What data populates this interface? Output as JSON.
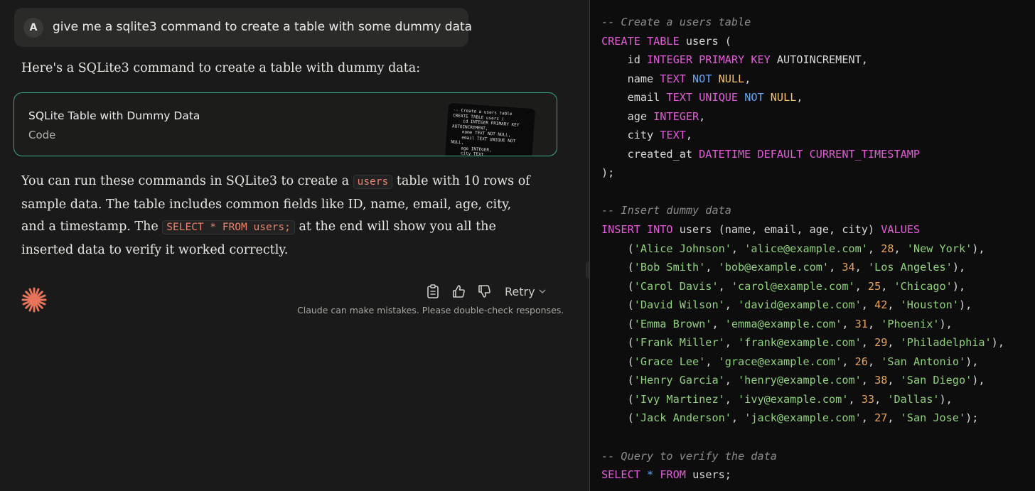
{
  "user_message": {
    "avatar_letter": "A",
    "text": "give me a sqlite3 command to create a table with some dummy data"
  },
  "response": {
    "intro": "Here's a SQLite3 command to create a table with dummy data:",
    "artifact": {
      "title": "SQLite Table with Dummy Data",
      "subtitle": "Code",
      "thumbnail_text": "-- Create a users table\nCREATE TABLE users (\n    id INTEGER PRIMARY KEY\nAUTOINCREMENT,\n    name TEXT NOT NULL,\n    email TEXT UNIQUE NOT\nNULL,\n    age INTEGER,\n    city TEXT,\n    created_..."
    },
    "body": {
      "part1": "You can run these commands in SQLite3 to create a ",
      "code1": "users",
      "part2": " table with 10 rows of sample data. The table includes common fields like ID, name, email, age, city, and a timestamp. The ",
      "code2": "SELECT * FROM users;",
      "part3": " at the end will show you all the inserted data to verify it worked correctly."
    },
    "actions": {
      "copy_icon": "clipboard-icon",
      "thumbs_up_icon": "thumbs-up-icon",
      "thumbs_down_icon": "thumbs-down-icon",
      "retry_label": "Retry"
    },
    "disclaimer": "Claude can make mistakes. Please double-check responses."
  },
  "code_panel": {
    "comment_create": "-- Create a users table",
    "comment_insert": "-- Insert dummy data",
    "comment_query": "-- Query to verify the data",
    "rows": [
      {
        "name": "'Alice Johnson'",
        "email": "'alice@example.com'",
        "age": "28",
        "city": "'New York'",
        "end": "),"
      },
      {
        "name": "'Bob Smith'",
        "email": "'bob@example.com'",
        "age": "34",
        "city": "'Los Angeles'",
        "end": "),"
      },
      {
        "name": "'Carol Davis'",
        "email": "'carol@example.com'",
        "age": "25",
        "city": "'Chicago'",
        "end": "),"
      },
      {
        "name": "'David Wilson'",
        "email": "'david@example.com'",
        "age": "42",
        "city": "'Houston'",
        "end": "),"
      },
      {
        "name": "'Emma Brown'",
        "email": "'emma@example.com'",
        "age": "31",
        "city": "'Phoenix'",
        "end": "),"
      },
      {
        "name": "'Frank Miller'",
        "email": "'frank@example.com'",
        "age": "29",
        "city": "'Philadelphia'",
        "end": "),"
      },
      {
        "name": "'Grace Lee'",
        "email": "'grace@example.com'",
        "age": "26",
        "city": "'San Antonio'",
        "end": "),"
      },
      {
        "name": "'Henry Garcia'",
        "email": "'henry@example.com'",
        "age": "38",
        "city": "'San Diego'",
        "end": "),"
      },
      {
        "name": "'Ivy Martinez'",
        "email": "'ivy@example.com'",
        "age": "33",
        "city": "'Dallas'",
        "end": "),"
      },
      {
        "name": "'Jack Anderson'",
        "email": "'jack@example.com'",
        "age": "27",
        "city": "'San Jose'",
        "end": ");"
      }
    ]
  },
  "colors": {
    "accent_border": "#3ba58a",
    "logo": "#e8745a",
    "keyword": "#e35bd8",
    "string": "#8fd07a",
    "number": "#e8a45b"
  }
}
